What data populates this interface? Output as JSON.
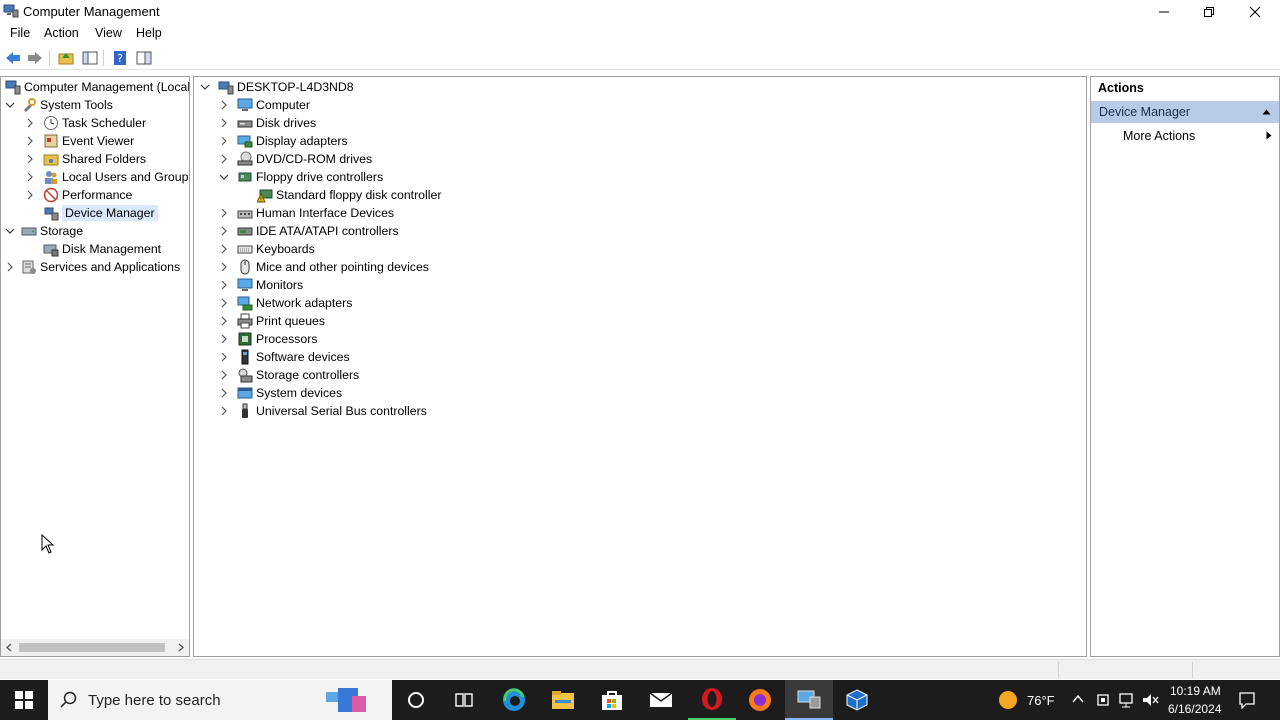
{
  "window": {
    "title": "Computer Management"
  },
  "menu": [
    "File",
    "Action",
    "View",
    "Help"
  ],
  "left_tree": {
    "root": "Computer Management (Local",
    "system_tools": "System Tools",
    "task_scheduler": "Task Scheduler",
    "event_viewer": "Event Viewer",
    "shared_folders": "Shared Folders",
    "local_users": "Local Users and Groups",
    "performance": "Performance",
    "device_manager": "Device Manager",
    "storage": "Storage",
    "disk_management": "Disk Management",
    "services": "Services and Applications"
  },
  "device_tree": {
    "root": "DESKTOP-L4D3ND8",
    "items": [
      "Computer",
      "Disk drives",
      "Display adapters",
      "DVD/CD-ROM drives",
      "Floppy drive controllers",
      "Standard floppy disk controller",
      "Human Interface Devices",
      "IDE ATA/ATAPI controllers",
      "Keyboards",
      "Mice and other pointing devices",
      "Monitors",
      "Network adapters",
      "Print queues",
      "Processors",
      "Software devices",
      "Storage controllers",
      "System devices",
      "Universal Serial Bus controllers"
    ]
  },
  "actions": {
    "header": "Actions",
    "section": "Device Manager",
    "more": "More Actions"
  },
  "taskbar": {
    "search_placeholder": "Type here to search",
    "weather": "76°F",
    "time": "10:19 AM",
    "date": "6/16/2024"
  }
}
